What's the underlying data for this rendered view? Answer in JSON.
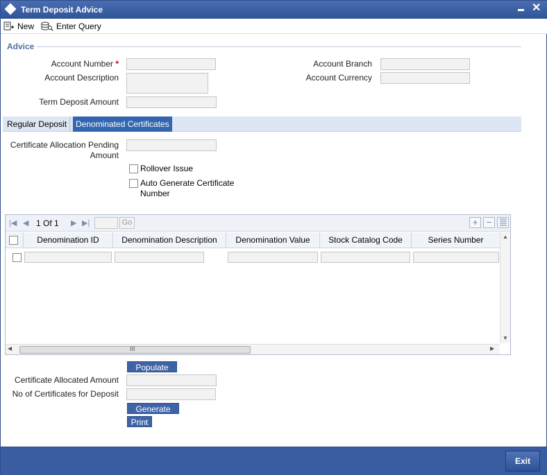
{
  "window": {
    "title": "Term Deposit Advice",
    "minimize_label": "",
    "close_glyph": "✕"
  },
  "toolbar": {
    "new_label": "New",
    "enter_query_label": "Enter Query"
  },
  "advice": {
    "section_label": "Advice",
    "account_number_label": "Account Number",
    "required_marker": "*",
    "account_number_value": "",
    "account_description_label": "Account Description",
    "account_description_value": "",
    "term_deposit_amount_label": "Term Deposit Amount",
    "term_deposit_amount_value": "",
    "account_branch_label": "Account Branch",
    "account_branch_value": "",
    "account_currency_label": "Account Currency",
    "account_currency_value": ""
  },
  "tabs": {
    "regular": "Regular Deposit",
    "denominated": "Denominated Certificates",
    "active": "denominated"
  },
  "denominated": {
    "pending_label": "Certificate Allocation Pending Amount",
    "pending_value": "",
    "rollover_label": "Rollover Issue",
    "rollover_checked": false,
    "autogen_label": "Auto Generate Certificate Number",
    "autogen_checked": false
  },
  "grid": {
    "pager": "1 Of 1",
    "go_label": "Go",
    "add_glyph": "+",
    "remove_glyph": "−",
    "columns": [
      "Denomination ID",
      "Denomination Description",
      "Denomination Value",
      "Stock Catalog Code",
      "Series Number"
    ],
    "rows": [
      {
        "denomination_id": "",
        "denomination_description": "",
        "denomination_value": "",
        "stock_catalog_code": "",
        "series_number": ""
      }
    ],
    "scroll_thumb_glyph": "III"
  },
  "actions": {
    "populate_label": "Populate",
    "allocated_amount_label": "Certificate Allocated Amount",
    "allocated_amount_value": "",
    "num_certs_label": "No of Certificates for Deposit",
    "num_certs_value": "",
    "generate_label": "Generate",
    "print_label": "Print"
  },
  "footer": {
    "exit_label": "Exit"
  },
  "colors": {
    "title_bar": "#2f5497",
    "tab_active": "#3466b0",
    "footer": "#3a5da1",
    "required": "#cc0000"
  }
}
